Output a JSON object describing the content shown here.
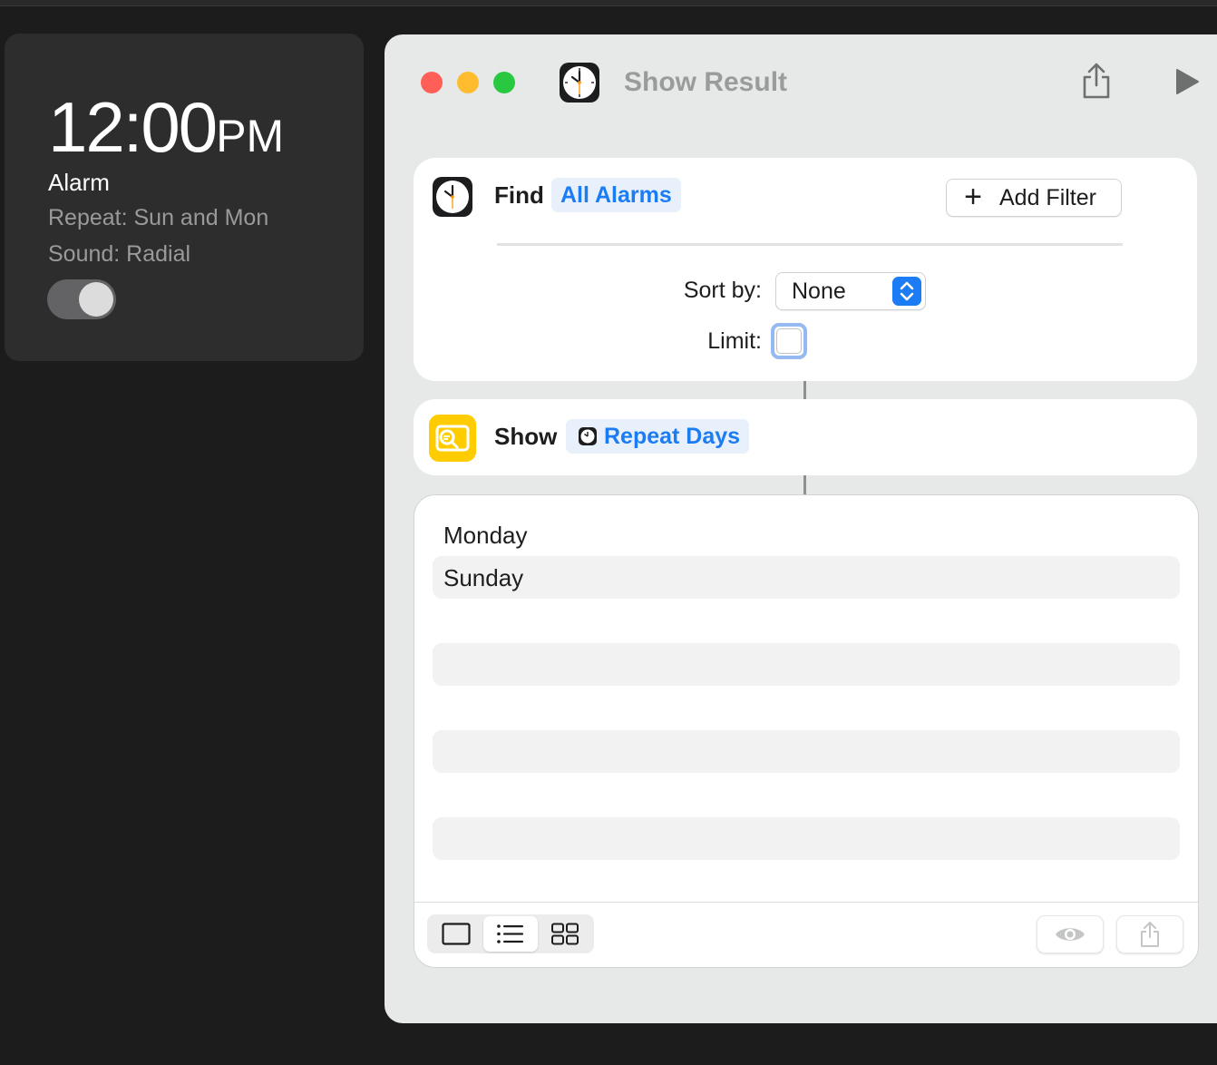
{
  "alarm": {
    "time": "12:00",
    "ampm": "PM",
    "label": "Alarm",
    "repeat": "Repeat: Sun and Mon",
    "sound": "Sound: Radial",
    "enabled": true
  },
  "window": {
    "title": "Show Result",
    "app_icon": "clock-icon",
    "toolbar_icons": [
      "share-icon",
      "play-icon"
    ]
  },
  "find_action": {
    "verb": "Find",
    "subject": "All Alarms",
    "add_filter_label": "Add Filter",
    "sort_label": "Sort by:",
    "sort_value": "None",
    "limit_label": "Limit:",
    "limit_enabled": false
  },
  "show_action": {
    "verb": "Show",
    "variable": "Repeat Days",
    "icon_color": "#ffcc00"
  },
  "result": {
    "items": [
      "Monday",
      "Sunday"
    ],
    "view_modes": [
      "single-item-icon",
      "list-icon",
      "grid-icon"
    ],
    "selected_view": "list",
    "footer_icons": [
      "eye-icon",
      "share-icon"
    ]
  },
  "colors": {
    "accent": "#1c7cf4",
    "close": "#ff5f57",
    "minimize": "#febc2e",
    "zoom": "#28c840"
  }
}
